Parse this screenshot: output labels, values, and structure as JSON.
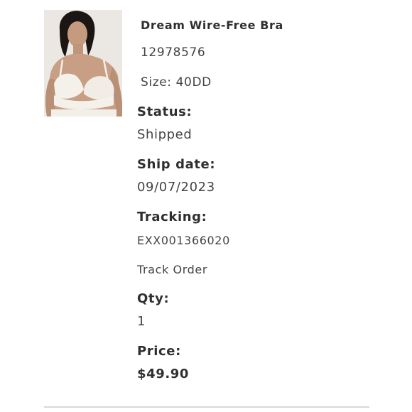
{
  "item": {
    "name": "Dream Wire-Free Bra",
    "sku": "12978576",
    "size": "Size: 40DD",
    "status_label": "Status:",
    "status_value": "Shipped",
    "ship_date_label": "Ship date:",
    "ship_date_value": "09/07/2023",
    "tracking_label": "Tracking:",
    "tracking_value": "EXX001366020",
    "track_link": "Track Order",
    "qty_label": "Qty:",
    "qty_value": "1",
    "price_label": "Price:",
    "price_value": "$49.90"
  },
  "colors": {
    "text": "#3a3a3a",
    "heading": "#2f2f2f",
    "divider": "#d9d9d9",
    "product_color": "#f4f1ea"
  }
}
